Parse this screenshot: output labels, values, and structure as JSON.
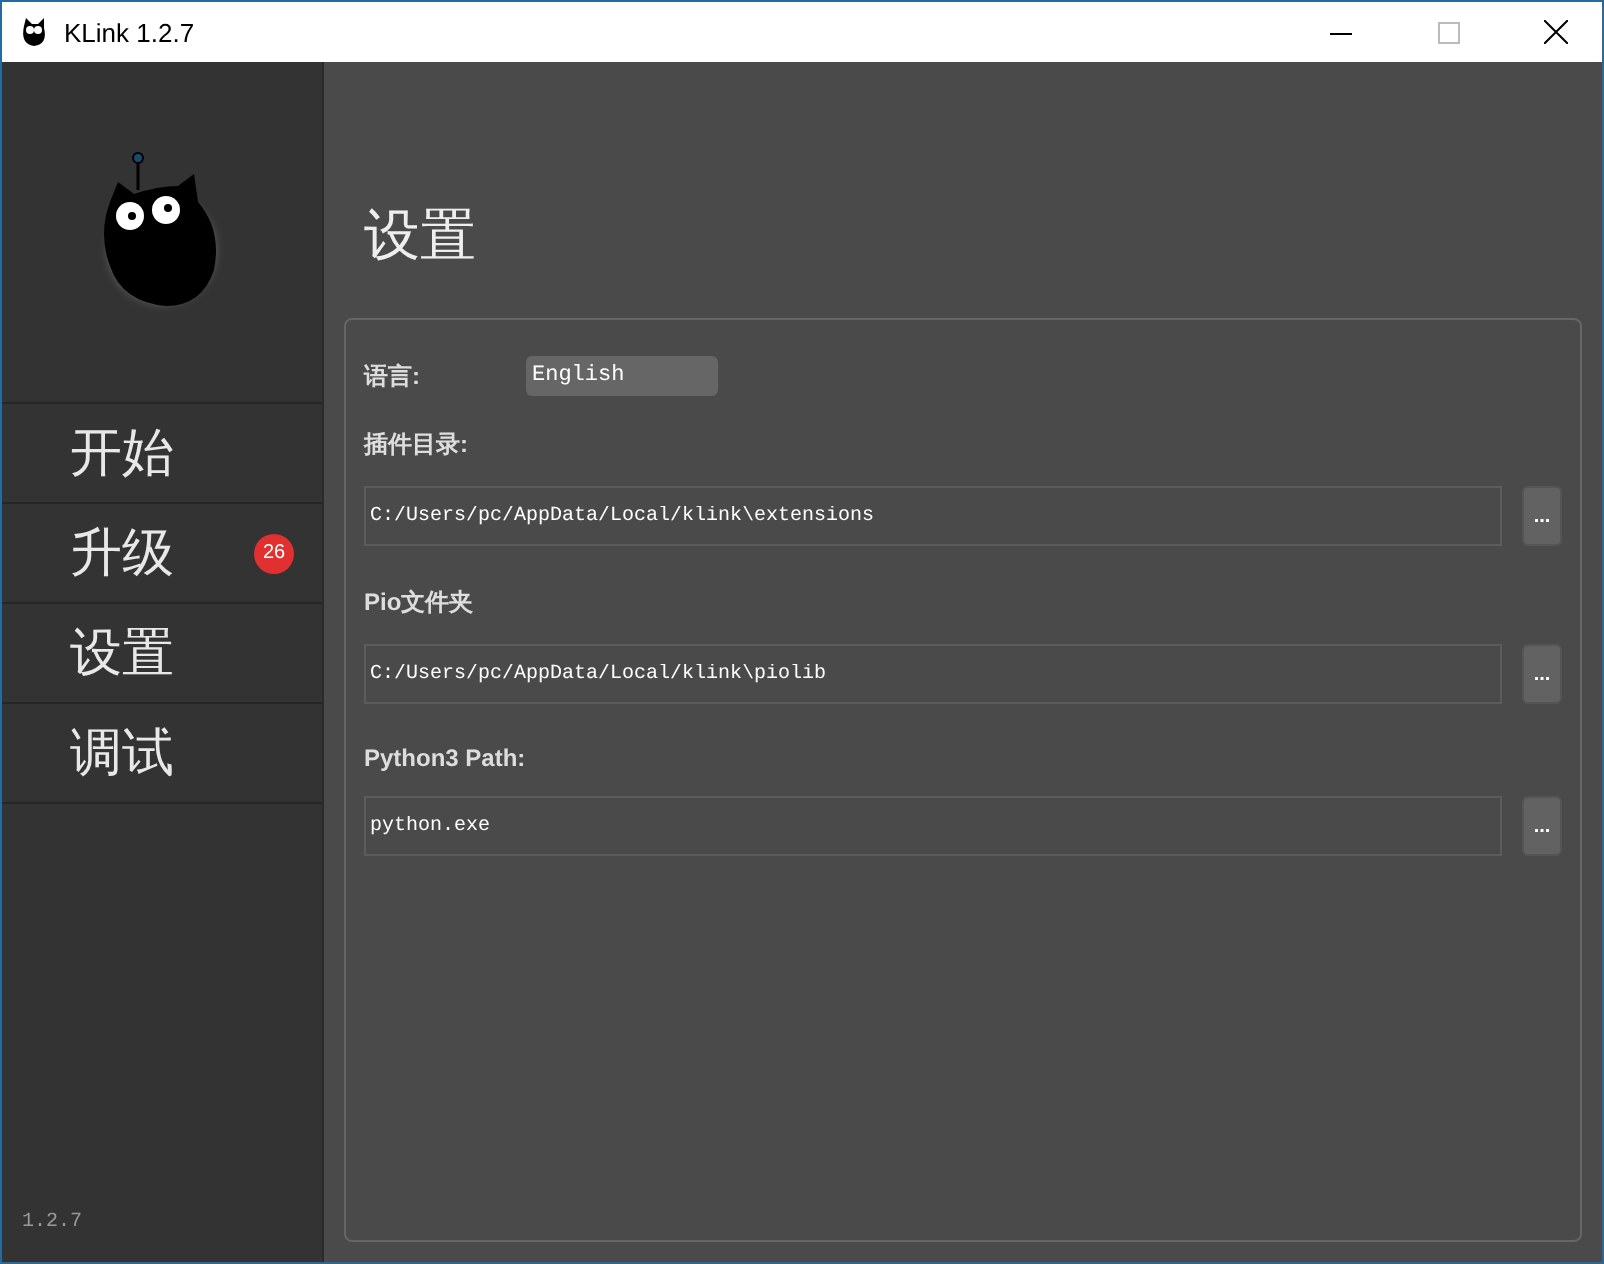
{
  "window": {
    "title": "KLink 1.2.7"
  },
  "sidebar": {
    "items": [
      {
        "label": "开始"
      },
      {
        "label": "升级",
        "badge": "26"
      },
      {
        "label": "设置"
      },
      {
        "label": "调试"
      }
    ],
    "version": "1.2.7"
  },
  "page": {
    "title": "设置",
    "language": {
      "label": "语言:",
      "value": "English"
    },
    "paths": [
      {
        "label": "插件目录:",
        "value": "C:/Users/pc/AppData/Local/klink\\extensions",
        "button": "..."
      },
      {
        "label": "Pio文件夹",
        "value": "C:/Users/pc/AppData/Local/klink\\piolib",
        "button": "..."
      },
      {
        "label": "Python3 Path:",
        "value": "python.exe",
        "button": "..."
      }
    ]
  }
}
